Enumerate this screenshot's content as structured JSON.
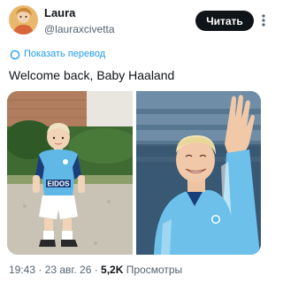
{
  "author": {
    "name": "Laura",
    "handle": "@lauraxcivetta",
    "avatar_icon": "avatar-portrait"
  },
  "follow_button": {
    "label": "Читать"
  },
  "more_icon": "more-vertical-icon",
  "translate": {
    "icon": "translate-icon",
    "label": "Показать перевод"
  },
  "tweet": {
    "text": "Welcome back, Baby Haaland"
  },
  "media": [
    {
      "description_icon": "photo-child-in-football-kit"
    },
    {
      "description_icon": "photo-player-waving"
    }
  ],
  "meta": {
    "time": "19:43",
    "separator": " · ",
    "date": "23 авг. 26",
    "views_count": "5,2K",
    "views_label": "Просмотры"
  },
  "colors": {
    "accent": "#1d9bf0",
    "text_primary": "#0f1419",
    "text_secondary": "#536471",
    "kit_sky_blue": "#5fb8e6"
  }
}
